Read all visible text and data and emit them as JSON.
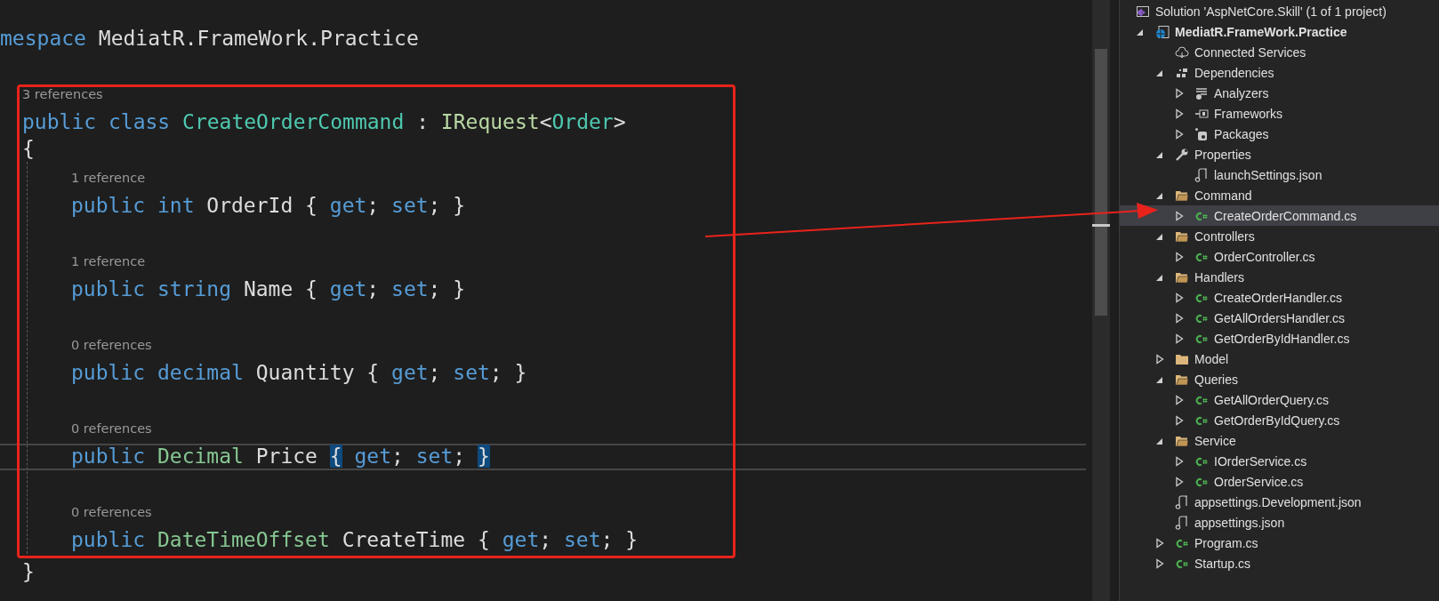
{
  "editor": {
    "namespace": [
      {
        "text": "mespace",
        "kind": "keyword"
      },
      {
        "text": " MediatR.FrameWork.Practice",
        "kind": "plain"
      }
    ],
    "class": {
      "lens": "3 references",
      "tokens": [
        {
          "text": "public",
          "kind": "keyword"
        },
        {
          "text": " class",
          "kind": "keyword"
        },
        {
          "text": " CreateOrderCommand",
          "kind": "type"
        },
        {
          "text": " : ",
          "kind": "plain"
        },
        {
          "text": "IRequest",
          "kind": "interface"
        },
        {
          "text": "<",
          "kind": "plain"
        },
        {
          "text": "Order",
          "kind": "type"
        },
        {
          "text": ">",
          "kind": "plain"
        }
      ],
      "open": "{",
      "close": "}",
      "members": [
        {
          "lens": "1 reference",
          "current": false,
          "tokens": [
            {
              "text": "public",
              "kind": "keyword"
            },
            {
              "text": " int",
              "kind": "keyword"
            },
            {
              "text": " OrderId { ",
              "kind": "plain"
            },
            {
              "text": "get",
              "kind": "keyword"
            },
            {
              "text": "; ",
              "kind": "plain"
            },
            {
              "text": "set",
              "kind": "keyword"
            },
            {
              "text": "; }",
              "kind": "plain"
            }
          ]
        },
        {
          "lens": "1 reference",
          "current": false,
          "tokens": [
            {
              "text": "public",
              "kind": "keyword"
            },
            {
              "text": " string",
              "kind": "keyword"
            },
            {
              "text": " Name { ",
              "kind": "plain"
            },
            {
              "text": "get",
              "kind": "keyword"
            },
            {
              "text": "; ",
              "kind": "plain"
            },
            {
              "text": "set",
              "kind": "keyword"
            },
            {
              "text": "; }",
              "kind": "plain"
            }
          ]
        },
        {
          "lens": "0 references",
          "current": false,
          "tokens": [
            {
              "text": "public",
              "kind": "keyword"
            },
            {
              "text": " decimal",
              "kind": "keyword"
            },
            {
              "text": " Quantity { ",
              "kind": "plain"
            },
            {
              "text": "get",
              "kind": "keyword"
            },
            {
              "text": "; ",
              "kind": "plain"
            },
            {
              "text": "set",
              "kind": "keyword"
            },
            {
              "text": "; }",
              "kind": "plain"
            }
          ]
        },
        {
          "lens": "0 references",
          "current": true,
          "tokens": [
            {
              "text": "public",
              "kind": "keyword"
            },
            {
              "text": " Decimal",
              "kind": "struct"
            },
            {
              "text": " Price ",
              "kind": "plain"
            },
            {
              "text": "{",
              "kind": "brace-match"
            },
            {
              "text": " get",
              "kind": "keyword"
            },
            {
              "text": "; ",
              "kind": "plain"
            },
            {
              "text": "set",
              "kind": "keyword"
            },
            {
              "text": "; ",
              "kind": "plain"
            },
            {
              "text": "}",
              "kind": "brace-match"
            }
          ]
        },
        {
          "lens": "0 references",
          "current": false,
          "tokens": [
            {
              "text": "public",
              "kind": "keyword"
            },
            {
              "text": " DateTimeOffset",
              "kind": "struct"
            },
            {
              "text": " CreateTime { ",
              "kind": "plain"
            },
            {
              "text": "get",
              "kind": "keyword"
            },
            {
              "text": "; ",
              "kind": "plain"
            },
            {
              "text": "set",
              "kind": "keyword"
            },
            {
              "text": "; }",
              "kind": "plain"
            }
          ]
        }
      ]
    }
  },
  "explorer": {
    "items": [
      {
        "label": "Solution 'AspNetCore.Skill' (1 of 1 project)",
        "kind": "solution",
        "selected": false,
        "children": [
          {
            "label": "MediatR.FrameWork.Practice",
            "kind": "project",
            "expanded": true,
            "selected": false,
            "children": [
              {
                "label": "Connected Services",
                "kind": "cloud",
                "selected": false
              },
              {
                "label": "Dependencies",
                "kind": "dependencies",
                "expanded": true,
                "selected": false,
                "children": [
                  {
                    "label": "Analyzers",
                    "kind": "analyzers",
                    "expanded": false,
                    "selected": false
                  },
                  {
                    "label": "Frameworks",
                    "kind": "frameworks",
                    "expanded": false,
                    "selected": false
                  },
                  {
                    "label": "Packages",
                    "kind": "packages",
                    "expanded": false,
                    "selected": false
                  }
                ]
              },
              {
                "label": "Properties",
                "kind": "wrench",
                "expanded": true,
                "selected": false,
                "children": [
                  {
                    "label": "launchSettings.json",
                    "kind": "json",
                    "selected": false
                  }
                ]
              },
              {
                "label": "Command",
                "kind": "folder",
                "expanded": true,
                "selected": false,
                "children": [
                  {
                    "label": "CreateOrderCommand.cs",
                    "kind": "csharp",
                    "expanded": false,
                    "selected": true
                  }
                ]
              },
              {
                "label": "Controllers",
                "kind": "folder",
                "expanded": true,
                "selected": false,
                "children": [
                  {
                    "label": "OrderController.cs",
                    "kind": "csharp",
                    "expanded": false,
                    "selected": false
                  }
                ]
              },
              {
                "label": "Handlers",
                "kind": "folder",
                "expanded": true,
                "selected": false,
                "children": [
                  {
                    "label": "CreateOrderHandler.cs",
                    "kind": "csharp",
                    "expanded": false,
                    "selected": false
                  },
                  {
                    "label": "GetAllOrdersHandler.cs",
                    "kind": "csharp",
                    "expanded": false,
                    "selected": false
                  },
                  {
                    "label": "GetOrderByIdHandler.cs",
                    "kind": "csharp",
                    "expanded": false,
                    "selected": false
                  }
                ]
              },
              {
                "label": "Model",
                "kind": "folder",
                "expanded": false,
                "selected": false
              },
              {
                "label": "Queries",
                "kind": "folder",
                "expanded": true,
                "selected": false,
                "children": [
                  {
                    "label": "GetAllOrderQuery.cs",
                    "kind": "csharp",
                    "expanded": false,
                    "selected": false
                  },
                  {
                    "label": "GetOrderByIdQuery.cs",
                    "kind": "csharp",
                    "expanded": false,
                    "selected": false
                  }
                ]
              },
              {
                "label": "Service",
                "kind": "folder",
                "expanded": true,
                "selected": false,
                "children": [
                  {
                    "label": "IOrderService.cs",
                    "kind": "csharp",
                    "expanded": false,
                    "selected": false
                  },
                  {
                    "label": "OrderService.cs",
                    "kind": "csharp",
                    "expanded": false,
                    "selected": false
                  }
                ]
              },
              {
                "label": "appsettings.Development.json",
                "kind": "json",
                "selected": false
              },
              {
                "label": "appsettings.json",
                "kind": "json",
                "selected": false
              },
              {
                "label": "Program.cs",
                "kind": "csharp",
                "expanded": false,
                "selected": false
              },
              {
                "label": "Startup.cs",
                "kind": "csharp",
                "expanded": false,
                "selected": false
              }
            ]
          }
        ]
      }
    ]
  }
}
